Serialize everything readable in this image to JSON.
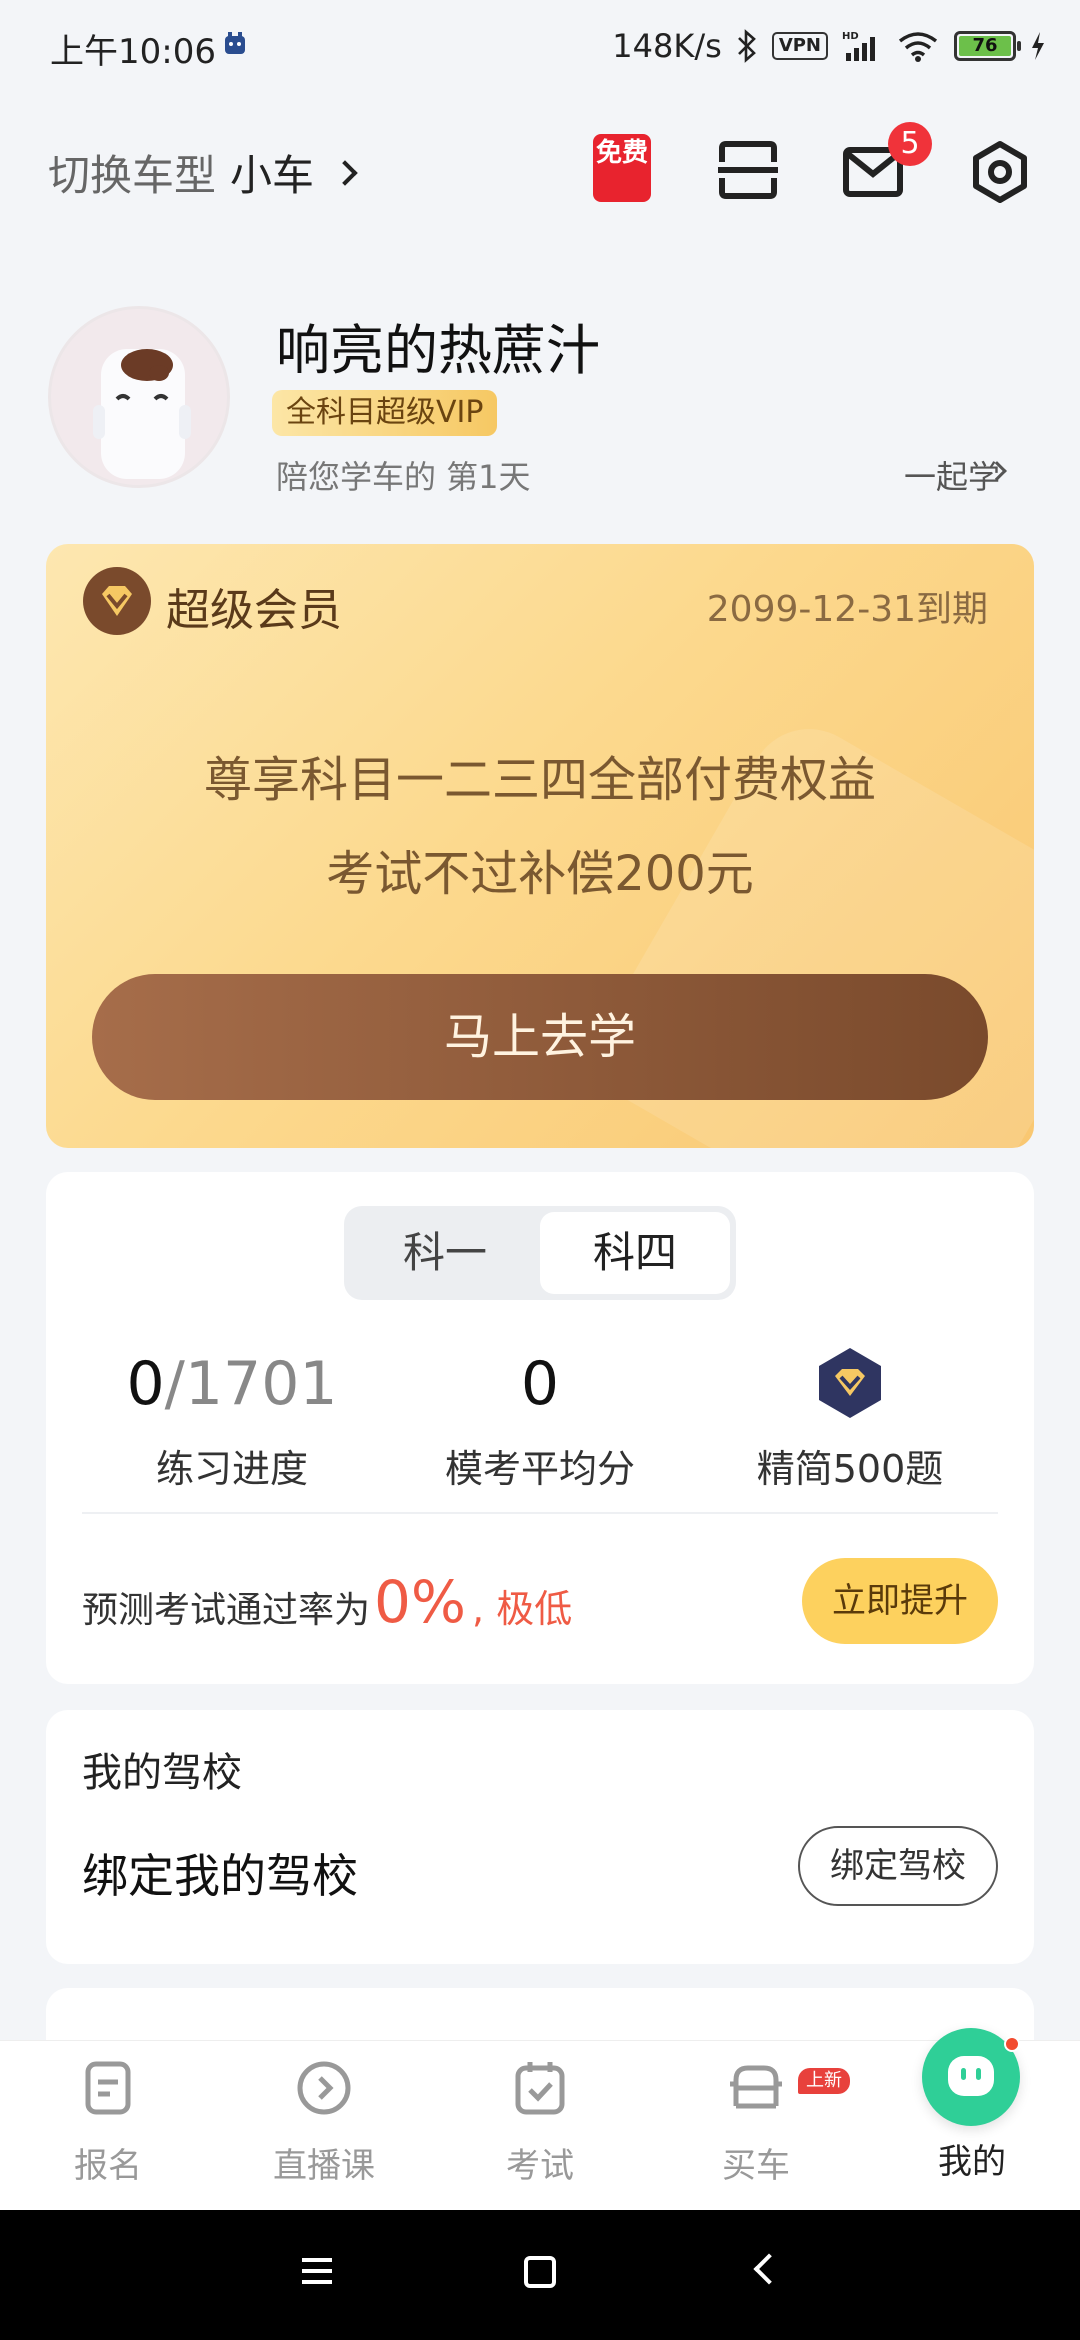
{
  "status_bar": {
    "time": "上午10:06",
    "speed": "148K/s",
    "vpn": "VPN",
    "battery": "76"
  },
  "header": {
    "switch_label": "切换车型",
    "car_type": "小车",
    "free_label": "免费",
    "mail_badge": "5"
  },
  "profile": {
    "name": "响亮的热蔗汁",
    "vip_tag": "全科目超级VIP",
    "days": "陪您学车的 第1天",
    "together": "一起学"
  },
  "vip_card": {
    "title": "超级会员",
    "expire": "2099-12-31到期",
    "line1": "尊享科目一二三四全部付费权益",
    "line2": "考试不过补偿200元",
    "button": "马上去学"
  },
  "stats": {
    "tabs": [
      "科一",
      "科四"
    ],
    "active_tab": 1,
    "progress_done": "0",
    "progress_total": "/1701",
    "progress_label": "练习进度",
    "avg_score": "0",
    "avg_label": "模考平均分",
    "premium_label": "精简500题",
    "predict_text": "预测考试通过率为",
    "predict_pct": "0%",
    "predict_level": ", 极低",
    "boost_button": "立即提升"
  },
  "school": {
    "title": "我的驾校",
    "bind_text": "绑定我的驾校",
    "bind_button": "绑定驾校"
  },
  "bottom_nav": {
    "items": [
      {
        "label": "报名",
        "icon": "form-icon"
      },
      {
        "label": "直播课",
        "icon": "play-icon"
      },
      {
        "label": "考试",
        "icon": "exam-icon"
      },
      {
        "label": "买车",
        "icon": "car-icon"
      },
      {
        "label": "我的",
        "icon": "profile-bubble-icon"
      }
    ],
    "new_badge": "上新",
    "active": 4
  },
  "colors": {
    "accent_red": "#ef5b45",
    "vip_gold": "#fcd98e",
    "button_brown": "#8a5434",
    "active_green": "#2fcf97"
  }
}
